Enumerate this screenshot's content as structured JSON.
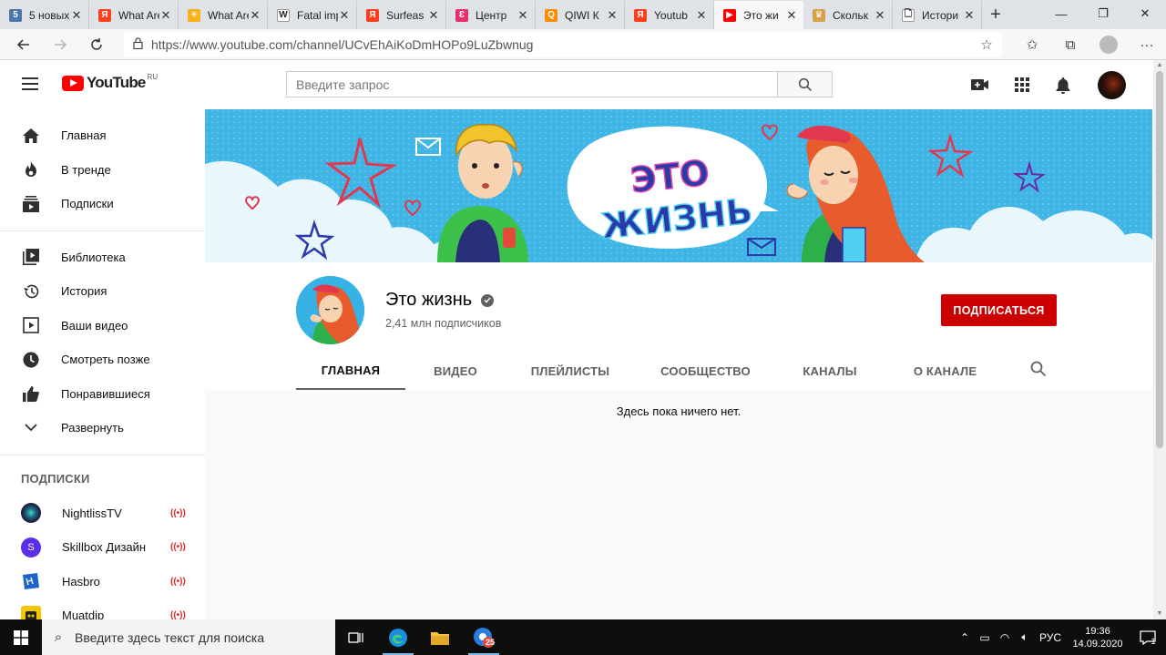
{
  "browser": {
    "tabs": [
      {
        "title": "5 новых",
        "favicon": "5",
        "color": "#4a76a8",
        "active": false
      },
      {
        "title": "What Are",
        "favicon": "Я",
        "color": "#fc3f1d",
        "active": false
      },
      {
        "title": "What Are",
        "favicon": "☀",
        "color": "#f6b21a",
        "active": false
      },
      {
        "title": "Fatal imp",
        "favicon": "W",
        "color": "#ffffff",
        "active": false
      },
      {
        "title": "Surfeas",
        "favicon": "Я",
        "color": "#fc3f1d",
        "active": false
      },
      {
        "title": "Центр",
        "favicon": "Ɛ",
        "color": "#e6306b",
        "active": false
      },
      {
        "title": "QIWI К",
        "favicon": "Q",
        "color": "#ff8c00",
        "active": false
      },
      {
        "title": "Youtub",
        "favicon": "Я",
        "color": "#fc3f1d",
        "active": false
      },
      {
        "title": "Это жи",
        "favicon": "▶",
        "color": "#ff0000",
        "active": true
      },
      {
        "title": "Скольк",
        "favicon": "♛",
        "color": "#d4a24c",
        "active": false
      },
      {
        "title": "Истори",
        "favicon": "🗋",
        "color": "#ffffff",
        "active": false
      }
    ],
    "url": "https://www.youtube.com/channel/UCvEhAiKoDmHOPo9LuZbwnug"
  },
  "youtube": {
    "logo_text": "YouTube",
    "logo_region": "RU",
    "search_placeholder": "Введите запрос"
  },
  "sidebar": {
    "main": [
      {
        "label": "Главная",
        "icon": "home-icon"
      },
      {
        "label": "В тренде",
        "icon": "trending-icon"
      },
      {
        "label": "Подписки",
        "icon": "subscriptions-icon"
      }
    ],
    "library": [
      {
        "label": "Библиотека",
        "icon": "library-icon"
      },
      {
        "label": "История",
        "icon": "history-icon"
      },
      {
        "label": "Ваши видео",
        "icon": "your-videos-icon"
      },
      {
        "label": "Смотреть позже",
        "icon": "watch-later-icon"
      },
      {
        "label": "Понравившиеся",
        "icon": "liked-icon"
      },
      {
        "label": "Развернуть",
        "icon": "chevron-down-icon"
      }
    ],
    "subscriptions_heading": "ПОДПИСКИ",
    "subscriptions": [
      {
        "name": "NightlissTV",
        "initial": "",
        "color": "#1d1d3a"
      },
      {
        "name": "Skillbox Дизайн",
        "initial": "S",
        "color": "#5b2ee8"
      },
      {
        "name": "Hasbro",
        "initial": "Hasbro",
        "color": "#1e63c7"
      },
      {
        "name": "Muatdip",
        "initial": "",
        "color": "#f3c600"
      }
    ]
  },
  "channel": {
    "banner_title_line1": "ЭТО",
    "banner_title_line2": "ЖИЗНЬ",
    "name": "Это жизнь",
    "subscribers": "2,41 млн подписчиков",
    "subscribe_label": "ПОДПИСАТЬСЯ",
    "tabs": [
      "ГЛАВНАЯ",
      "ВИДЕО",
      "ПЛЕЙЛИСТЫ",
      "СООБЩЕСТВО",
      "КАНАЛЫ",
      "О КАНАЛЕ"
    ],
    "active_tab": "ГЛАВНАЯ",
    "empty_message": "Здесь пока ничего нет."
  },
  "taskbar": {
    "search_placeholder": "Введите здесь текст для поиска",
    "language": "РУС",
    "time": "19:36",
    "date": "14.09.2020",
    "edge_badge": "25",
    "notifications_count": "1"
  }
}
